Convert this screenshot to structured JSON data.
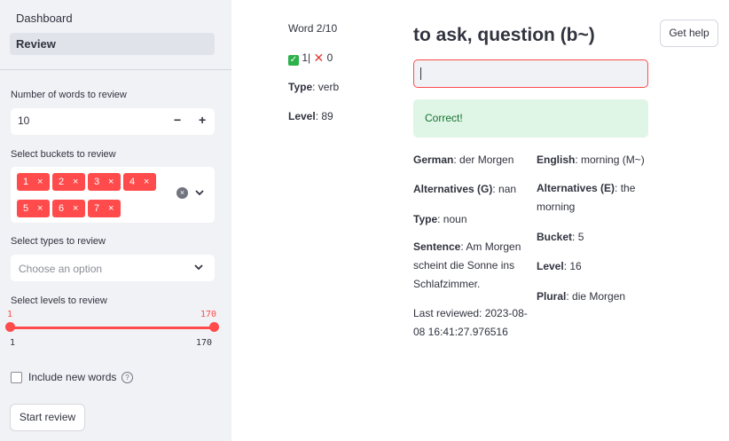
{
  "sidebar": {
    "nav": {
      "dashboard": "Dashboard",
      "review": "Review"
    },
    "num_words": {
      "label": "Number of words to review",
      "value": "10",
      "minus": "−",
      "plus": "+"
    },
    "buckets": {
      "label": "Select buckets to review",
      "chips": [
        "1",
        "2",
        "3",
        "4",
        "5",
        "6",
        "7"
      ],
      "chip_close": "×"
    },
    "types": {
      "label": "Select types to review",
      "placeholder": "Choose an option"
    },
    "levels": {
      "label": "Select levels to review",
      "min_value": "1",
      "max_value": "170",
      "range_min": "1",
      "range_max": "170"
    },
    "include_new": {
      "label": "Include new words",
      "checked": false
    },
    "start_button": "Start review"
  },
  "review": {
    "word_counter": "Word 2/10",
    "score": {
      "correct": "1",
      "separator": "|",
      "wrong": "0"
    },
    "type": {
      "label": "Type",
      "value": "verb"
    },
    "level": {
      "label": "Level",
      "value": "89"
    },
    "prompt_title": "to ask, question (b~)",
    "answer_value": "",
    "feedback": "Correct!",
    "help_button": "Get help"
  },
  "details": {
    "left": [
      {
        "label": "German",
        "value": "der Morgen"
      },
      {
        "label": "Alternatives (G)",
        "value": "nan"
      },
      {
        "label": "Type",
        "value": "noun"
      },
      {
        "label": "Sentence",
        "value": "Am Morgen scheint die Sonne ins Schlafzimmer."
      }
    ],
    "last_reviewed": "Last reviewed: 2023-08-08 16:41:27.976516",
    "right": [
      {
        "label": "English",
        "value": "morning (M~)"
      },
      {
        "label": "Alternatives (E)",
        "value": "the morning"
      },
      {
        "label": "Bucket",
        "value": "5"
      },
      {
        "label": "Level",
        "value": "16"
      },
      {
        "label": "Plural",
        "value": "die Morgen"
      }
    ]
  },
  "colors": {
    "accent": "#ff4b4b",
    "sidebar_bg": "#f0f2f6",
    "success_bg": "#dff5e5",
    "success_text": "#177233"
  }
}
